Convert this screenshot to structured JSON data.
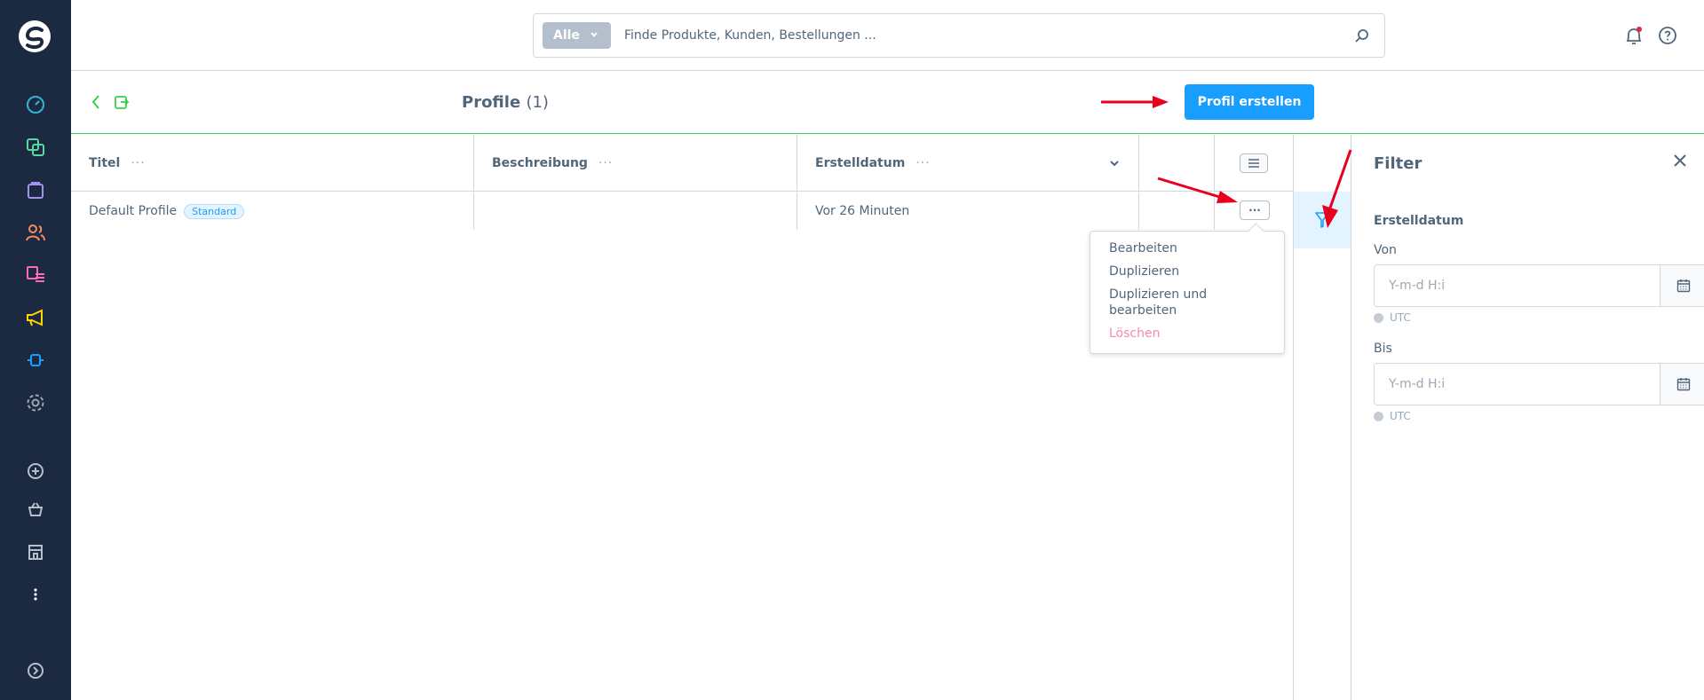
{
  "header": {
    "search_scope": "Alle",
    "search_placeholder": "Finde Produkte, Kunden, Bestellungen ..."
  },
  "smartbar": {
    "title": "Profile",
    "count": "(1)",
    "create_button": "Profil erstellen"
  },
  "grid": {
    "columns": [
      "Titel",
      "Beschreibung",
      "Erstelldatum"
    ],
    "rows": [
      {
        "title": "Default Profile",
        "badge": "Standard",
        "description": "",
        "created": "Vor 26 Minuten"
      }
    ]
  },
  "context_menu": {
    "items": [
      "Bearbeiten",
      "Duplizieren",
      "Duplizieren und bearbeiten",
      "Löschen"
    ]
  },
  "filter": {
    "title": "Filter",
    "group": "Erstelldatum",
    "from_label": "Von",
    "to_label": "Bis",
    "placeholder": "Y-m-d H:i",
    "timezone": "UTC"
  },
  "colors": {
    "sidebar": "#1b2a40",
    "primary": "#189eff",
    "success": "#37d046",
    "annotation": "#e8001c"
  },
  "sidebar_icons": [
    "dashboard-icon",
    "catalogue-icon",
    "orders-icon",
    "customers-icon",
    "content-icon",
    "marketing-icon",
    "extensions-icon",
    "settings-icon",
    "add-icon",
    "sales-channel-basket-icon",
    "storefront-icon",
    "more-icon",
    "expand-icon"
  ]
}
